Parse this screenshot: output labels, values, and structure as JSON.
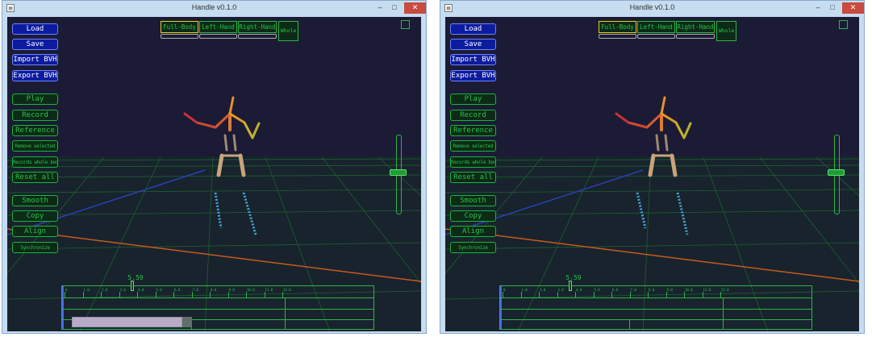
{
  "windows": [
    {
      "title": "Handle v0.1.0",
      "controls": {
        "minimize": "–",
        "maximize": "□",
        "close": "✕"
      },
      "buttons": {
        "load": "Load",
        "save": "Save",
        "import_bvh": "Import BVH",
        "export_bvh": "Export BVH",
        "play": "Play",
        "record": "Record",
        "reference": "Reference",
        "remove_selected": "Remove selected",
        "records_whole_body": "Records whole body",
        "reset_all": "Reset all",
        "smooth": "Smooth",
        "copy": "Copy",
        "align": "Align",
        "synchronize": "Synchronize"
      },
      "body_modes": {
        "full_body": "Full-Body",
        "left_hand": "Left-Hand",
        "right_hand": "Right-Hand",
        "whole": "Whole"
      },
      "selected_body_mode": "Full-Body",
      "timeline": {
        "current_time": "5.59",
        "tick_labels": [
          "0",
          "1.0",
          "2.0",
          "3.0",
          "4.0",
          "5.0",
          "6.0",
          "7.0",
          "8.0",
          "9.0",
          "10.0",
          "11.0",
          "12.0"
        ],
        "clip_visible": true
      }
    },
    {
      "title": "Handle v0.1.0",
      "controls": {
        "minimize": "–",
        "maximize": "□",
        "close": "✕"
      },
      "buttons": {
        "load": "Load",
        "save": "Save",
        "import_bvh": "Import BVH",
        "export_bvh": "Export BVH",
        "play": "Play",
        "record": "Record",
        "reference": "Reference",
        "remove_selected": "Remove selected",
        "records_whole_body": "Records whole body",
        "reset_all": "Reset all",
        "smooth": "Smooth",
        "copy": "Copy",
        "align": "Align",
        "synchronize": "Synchronize"
      },
      "body_modes": {
        "full_body": "Full-Body",
        "left_hand": "Left-Hand",
        "right_hand": "Right-Hand",
        "whole": "Whole"
      },
      "selected_body_mode": "Full-Body",
      "timeline": {
        "current_time": "5.59",
        "tick_labels": [
          "0",
          "1.0",
          "2.0",
          "3.0",
          "4.0",
          "5.0",
          "6.0",
          "7.0",
          "8.0",
          "9.0",
          "10.0",
          "11.0",
          "12.0"
        ],
        "clip_visible": false
      }
    }
  ],
  "colors": {
    "viewport_bg": "#1b1b36",
    "ui_green": "#29c247",
    "ui_blue": "#0d1b9e",
    "selection_yellow": "#e6d21c",
    "titlebar": "#c6dcf0",
    "close_red": "#c94a3e"
  }
}
